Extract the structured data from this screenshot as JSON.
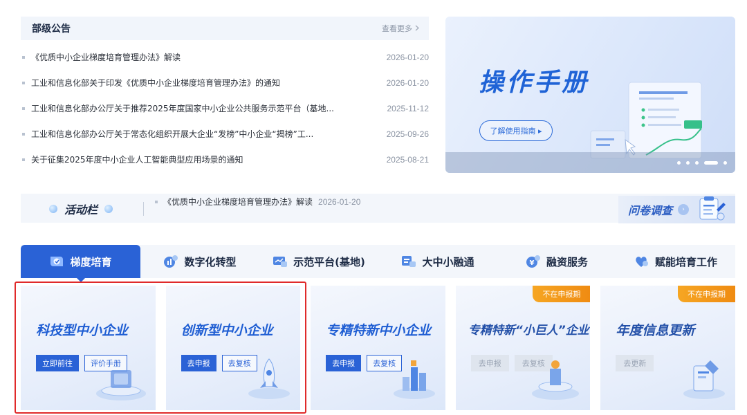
{
  "notice": {
    "title": "部级公告",
    "more_label": "查看更多",
    "items": [
      {
        "text": "《优质中小企业梯度培育管理办法》解读",
        "date": "2026-01-20"
      },
      {
        "text": "工业和信息化部关于印发《优质中小企业梯度培育管理办法》的通知",
        "date": "2026-01-20"
      },
      {
        "text": "工业和信息化部办公厅关于推荐2025年度国家中小企业公共服务示范平台（基地...",
        "date": "2025-11-12"
      },
      {
        "text": "工业和信息化部办公厅关于常态化组织开展大企业“发榜”中小企业“揭榜”工...",
        "date": "2025-09-26"
      },
      {
        "text": "关于征集2025年度中小企业人工智能典型应用场景的通知",
        "date": "2025-08-21"
      }
    ]
  },
  "banner": {
    "title": "操作手册",
    "button_label": "了解使用指南 ▸",
    "slide_count": 5,
    "active_slide": 4
  },
  "activity": {
    "label": "活动栏",
    "item_text": "《优质中小企业梯度培育管理办法》解读",
    "item_date": "2026-01-20"
  },
  "survey": {
    "label": "问卷调查",
    "arrow": "›"
  },
  "tabs": [
    {
      "label": "梯度培育",
      "icon": "cultivation-icon",
      "active": true
    },
    {
      "label": "数字化转型",
      "icon": "digital-chart-icon",
      "active": false
    },
    {
      "label": "示范平台(基地)",
      "icon": "platform-monitor-icon",
      "active": false
    },
    {
      "label": "大中小融通",
      "icon": "integration-icon",
      "active": false
    },
    {
      "label": "融资服务",
      "icon": "finance-icon",
      "active": false
    },
    {
      "label": "赋能培育工作",
      "icon": "empower-heart-icon",
      "active": false
    }
  ],
  "cards": [
    {
      "title": "科技型中小企业",
      "buttons": [
        {
          "label": "立即前往",
          "style": "primary"
        },
        {
          "label": "评价手册",
          "style": "outline"
        }
      ],
      "badge": ""
    },
    {
      "title": "创新型中小企业",
      "buttons": [
        {
          "label": "去申报",
          "style": "primary"
        },
        {
          "label": "去复核",
          "style": "outline"
        }
      ],
      "badge": ""
    },
    {
      "title": "专精特新中小企业",
      "buttons": [
        {
          "label": "去申报",
          "style": "primary"
        },
        {
          "label": "去复核",
          "style": "outline"
        }
      ],
      "badge": ""
    },
    {
      "title": "专精特新“小巨人”企业",
      "buttons": [
        {
          "label": "去申报",
          "style": "disabled"
        },
        {
          "label": "去复核",
          "style": "disabled"
        }
      ],
      "badge": "不在申报期"
    },
    {
      "title": "年度信息更新",
      "buttons": [
        {
          "label": "去更新",
          "style": "disabled"
        }
      ],
      "badge": "不在申报期"
    }
  ],
  "colors": {
    "primary": "#2a62d6",
    "badge": "#f39a1c",
    "highlight": "#e02a2a"
  }
}
